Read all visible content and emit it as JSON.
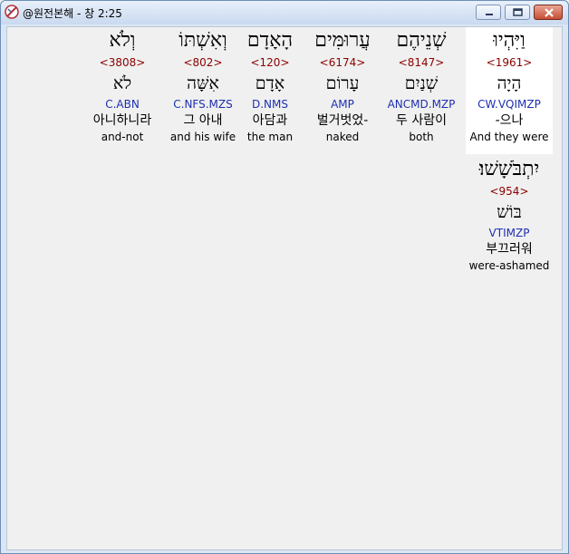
{
  "window": {
    "title": "@원전본해 - 창 2:25",
    "minimize_label": "minimize",
    "maximize_label": "maximize",
    "close_label": "close"
  },
  "words_row1": [
    {
      "hebrew": "וְלֹא",
      "strong": "<3808>",
      "lemma": "לֹא",
      "code": "C.ABN",
      "korean": "아니하니라",
      "english": "and-not"
    },
    {
      "hebrew": "וְאִשְׁתּוֹ",
      "strong": "<802>",
      "lemma": "אִשָּׁה",
      "code": "C.NFS.MZS",
      "korean": "그 아내",
      "english": "and his wife"
    },
    {
      "hebrew": "הָאָדָם",
      "strong": "<120>",
      "lemma": "אָדָם",
      "code": "D.NMS",
      "korean": "아담과",
      "english": "the man"
    },
    {
      "hebrew": "עֲרוּמִּים",
      "strong": "<6174>",
      "lemma": "עָרוֹם",
      "code": "AMP",
      "korean": "벌거벗었-",
      "english": "naked"
    },
    {
      "hebrew": "שְׁנֵיהֶם",
      "strong": "<8147>",
      "lemma": "שְׁנַיִם",
      "code": "ANCMD.MZP",
      "korean": "두 사람이",
      "english": "both"
    },
    {
      "hebrew": "וַיִּהְיוּ",
      "strong": "<1961>",
      "lemma": "הָיָה",
      "code": "CW.VQIMZP",
      "korean": "-으나",
      "english": "And they were"
    }
  ],
  "words_row2": [
    {
      "hebrew": "יִתְבֹּשָׁשׁוּ׃",
      "strong": "<954>",
      "lemma": "בּוֹשׁ",
      "code": "VTIMZP",
      "korean": "부끄러워",
      "english": "were-ashamed"
    }
  ],
  "colors": {
    "strong_number": "#8b0000",
    "morph_code": "#1f2fb0",
    "highlight": "#ffffff",
    "close_button": "#c74d33"
  }
}
